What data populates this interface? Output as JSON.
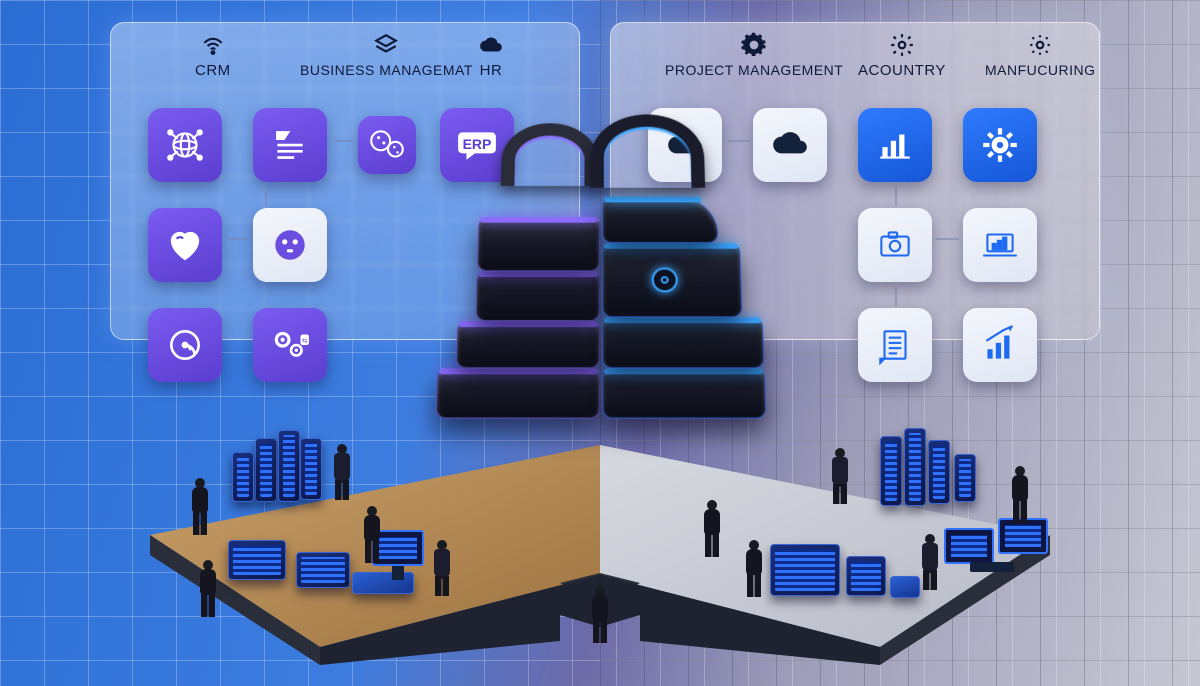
{
  "headers": {
    "left": [
      {
        "name": "crm",
        "label": "CRM"
      },
      {
        "name": "bizmgmt",
        "label": "BUSINESS MANAGEMAT"
      },
      {
        "name": "hr",
        "label": "HR"
      }
    ],
    "right": [
      {
        "name": "projmgmt",
        "label": "PROJECT MANAGEMENT"
      },
      {
        "name": "acountry",
        "label": "ACOUNTRY"
      },
      {
        "name": "manuf",
        "label": "MANFUCURING"
      }
    ]
  },
  "tiles": {
    "erp_label": "ERP"
  },
  "colors": {
    "purple": "#6b4de0",
    "blue": "#1f6af2",
    "panel": "#e4ecfb"
  }
}
